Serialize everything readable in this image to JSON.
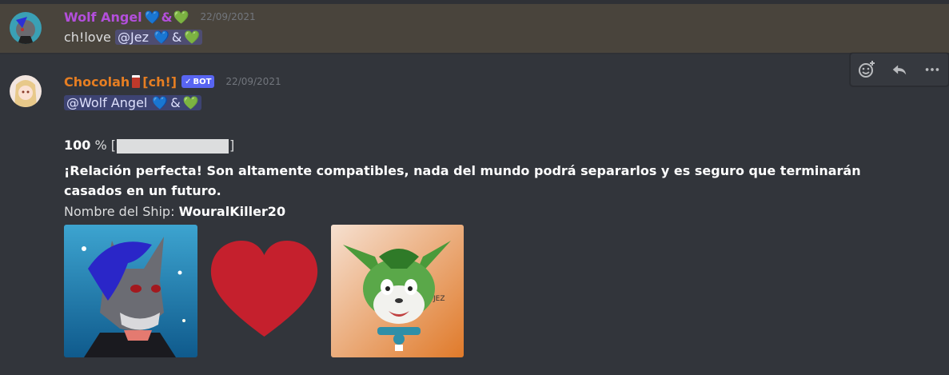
{
  "messages": [
    {
      "author": "Wolf Angel",
      "author_color": "#b34fdb",
      "name_hearts": {
        "blue": "💙",
        "amp": "&",
        "green": "💚"
      },
      "timestamp": "22/09/2021",
      "content_prefix": "ch!love",
      "mention": "@Jez",
      "mention_hearts": {
        "blue": "💙",
        "amp": "&",
        "green": "💚"
      }
    },
    {
      "author": "Chocolah",
      "author_suffix": "[ch!]",
      "author_color": "#e67e22",
      "bot_badge": "BOT",
      "bot_check": "✓",
      "timestamp": "22/09/2021",
      "mention": "@Wolf Angel",
      "mention_hearts": {
        "blue": "💙",
        "amp": "&",
        "green": "💚"
      },
      "percent_value": "100",
      "percent_sign": "%",
      "bracket_open": "[",
      "bracket_close": "]",
      "progress": 1.0,
      "verdict": "¡Relación perfecta! Son altamente compatibles, nada del mundo podrá separarlos y es seguro que terminarán casados en un futuro.",
      "ship_label": "Nombre del Ship:",
      "ship_name": "WouralKiller20",
      "images": [
        "wolf-avatar-image",
        "red-heart-image",
        "jez-avatar-image"
      ]
    }
  ],
  "toolbar": {
    "add_reaction": "add-reaction-icon",
    "reply": "reply-icon",
    "more": "more-icon"
  },
  "colors": {
    "background": "#36393f",
    "highlight": "#49443c",
    "mention_bg": "#5865f2",
    "heart_red": "#c5202d"
  }
}
